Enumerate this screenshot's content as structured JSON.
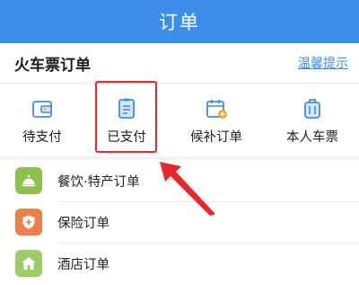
{
  "header": {
    "title": "订单"
  },
  "train_orders": {
    "title": "火车票订单",
    "tip_link": "温馨提示",
    "entries": [
      {
        "label": "待支付",
        "icon": "wallet-icon"
      },
      {
        "label": "已支付",
        "icon": "document-icon"
      },
      {
        "label": "候补订单",
        "icon": "calendar-add-icon"
      },
      {
        "label": "本人车票",
        "icon": "luggage-icon"
      }
    ]
  },
  "other_orders": [
    {
      "label": "餐饮·特产订单",
      "icon": "food-cloche-icon",
      "color": "#8bc34a"
    },
    {
      "label": "保险订单",
      "icon": "shield-icon",
      "color": "#f07e48"
    },
    {
      "label": "酒店订单",
      "icon": "hotel-icon",
      "color": "#9ccc65"
    }
  ],
  "colors": {
    "accent": "#3d8ee8",
    "highlight": "#e8262f"
  }
}
